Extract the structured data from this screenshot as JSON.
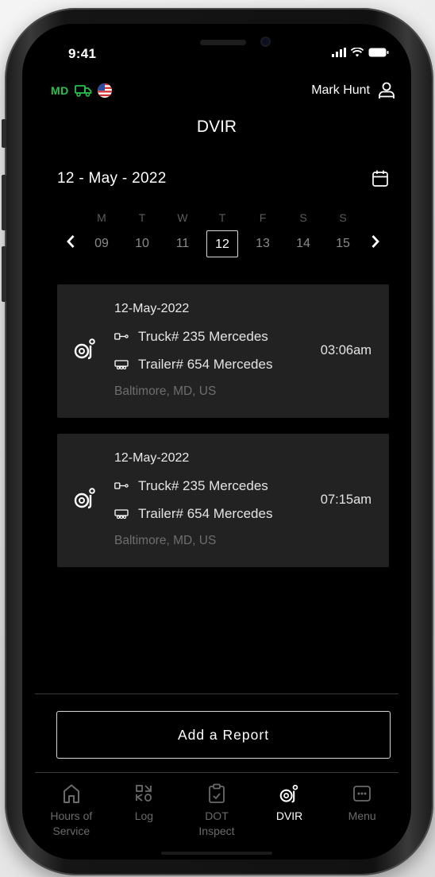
{
  "status_bar": {
    "time": "9:41"
  },
  "header": {
    "state_code": "MD",
    "user_name": "Mark Hunt",
    "title": "DVIR"
  },
  "date_selector": {
    "current_date": "12 - May - 2022",
    "days": [
      {
        "name": "M",
        "num": "09"
      },
      {
        "name": "T",
        "num": "10"
      },
      {
        "name": "W",
        "num": "11"
      },
      {
        "name": "T",
        "num": "12",
        "selected": true
      },
      {
        "name": "F",
        "num": "13"
      },
      {
        "name": "S",
        "num": "14"
      },
      {
        "name": "S",
        "num": "15"
      }
    ]
  },
  "reports": [
    {
      "date": "12-May-2022",
      "truck": "Truck# 235 Mercedes",
      "trailer": "Trailer# 654 Mercedes",
      "location": "Baltimore, MD, US",
      "time": "03:06am"
    },
    {
      "date": "12-May-2022",
      "truck": "Truck# 235 Mercedes",
      "trailer": "Trailer# 654 Mercedes",
      "location": "Baltimore, MD, US",
      "time": "07:15am"
    }
  ],
  "add_report_label": "Add a Report",
  "tabs": [
    {
      "label": "Hours of\nService",
      "icon": "home-icon"
    },
    {
      "label": "Log",
      "icon": "log-icon"
    },
    {
      "label": "DOT\nInspect",
      "icon": "clipboard-check-icon"
    },
    {
      "label": "DVIR",
      "icon": "dvir-icon",
      "active": true
    },
    {
      "label": "Menu",
      "icon": "menu-icon"
    }
  ],
  "colors": {
    "background": "#000000",
    "card": "#222222",
    "accent_green": "#27c24c",
    "muted_text": "#6e6e6e",
    "selected_border": "#d8d8d8"
  }
}
